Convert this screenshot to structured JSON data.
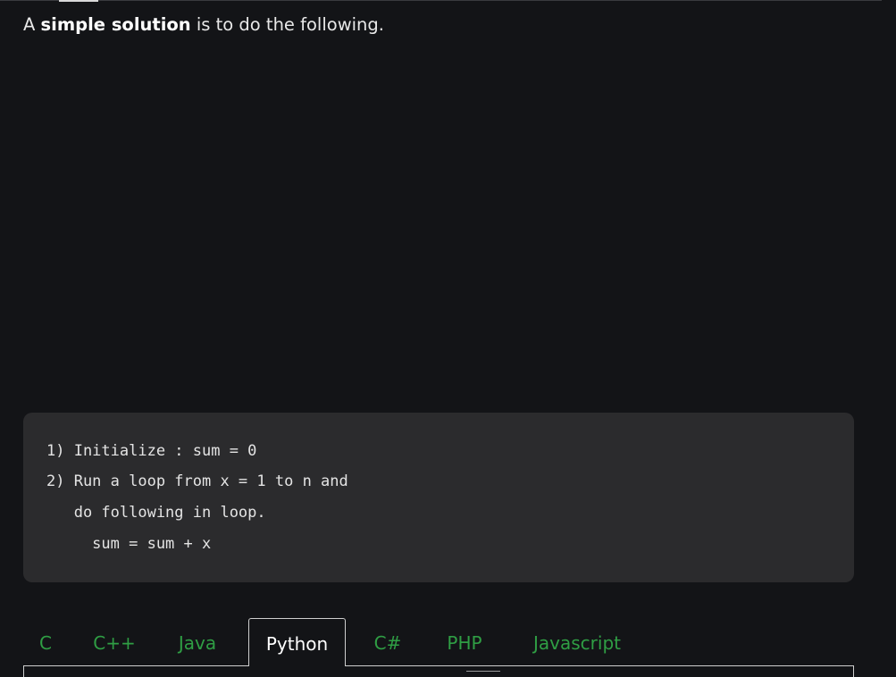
{
  "intro": {
    "prefix": "A ",
    "emphasis": "simple solution",
    "suffix": " is to do the following."
  },
  "code_block": {
    "lines": [
      "1) Initialize : sum = 0",
      "2) Run a loop from x = 1 to n and",
      "   do following in loop.",
      "     sum = sum + x"
    ]
  },
  "language_tabs": {
    "items": [
      "C",
      "C++",
      "Java",
      "Python",
      "C#",
      "PHP",
      "Javascript"
    ],
    "active": "Python"
  },
  "colors": {
    "background": "#131417",
    "code_background": "#2b2b2d",
    "tab_link": "#2f9e44",
    "text": "#e8e8e8"
  }
}
